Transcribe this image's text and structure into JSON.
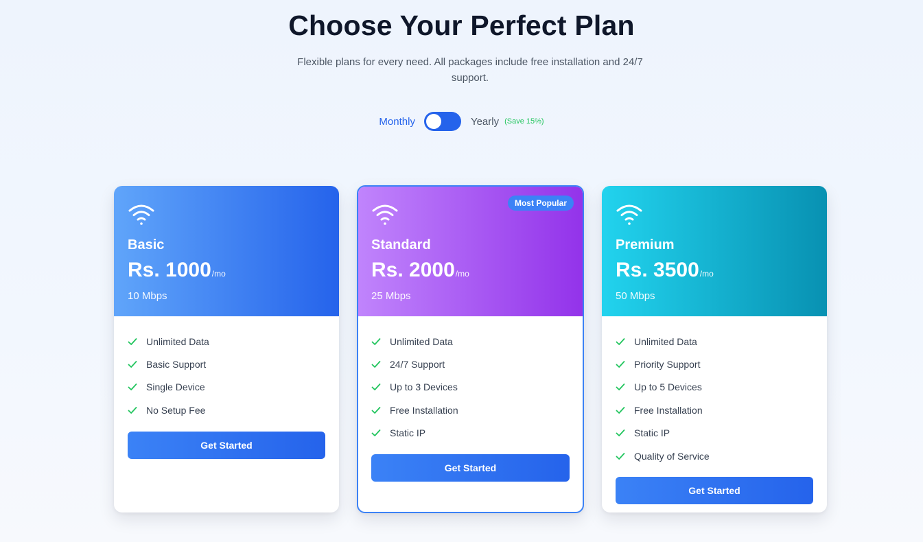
{
  "header": {
    "title": "Choose Your Perfect Plan",
    "subtitle": "Flexible plans for every need. All packages include free installation and 24/7 support."
  },
  "billing_toggle": {
    "monthly_label": "Monthly",
    "yearly_label": "Yearly",
    "save_badge": "(Save 15%)",
    "selected": "Monthly"
  },
  "plans": [
    {
      "name": "Basic",
      "price": "Rs. 1000",
      "period": "/mo",
      "speed": "10 Mbps",
      "icon": "wifi-icon",
      "features": [
        "Unlimited Data",
        "Basic Support",
        "Single Device",
        "No Setup Fee"
      ],
      "cta": "Get Started"
    },
    {
      "name": "Standard",
      "price": "Rs. 2000",
      "period": "/mo",
      "speed": "25 Mbps",
      "icon": "wifi-icon",
      "badge": "Most Popular",
      "features": [
        "Unlimited Data",
        "24/7 Support",
        "Up to 3 Devices",
        "Free Installation",
        "Static IP"
      ],
      "cta": "Get Started"
    },
    {
      "name": "Premium",
      "price": "Rs. 3500",
      "period": "/mo",
      "speed": "50 Mbps",
      "icon": "wifi-icon",
      "features": [
        "Unlimited Data",
        "Priority Support",
        "Up to 5 Devices",
        "Free Installation",
        "Static IP",
        "Quality of Service"
      ],
      "cta": "Get Started"
    }
  ],
  "colors": {
    "accent": "#2563eb",
    "check": "#22c55e",
    "basic_gradient": [
      "#60a5fa",
      "#2563eb"
    ],
    "standard_gradient": [
      "#c084fc",
      "#9333ea"
    ],
    "premium_gradient": [
      "#22d3ee",
      "#0891b2"
    ]
  }
}
